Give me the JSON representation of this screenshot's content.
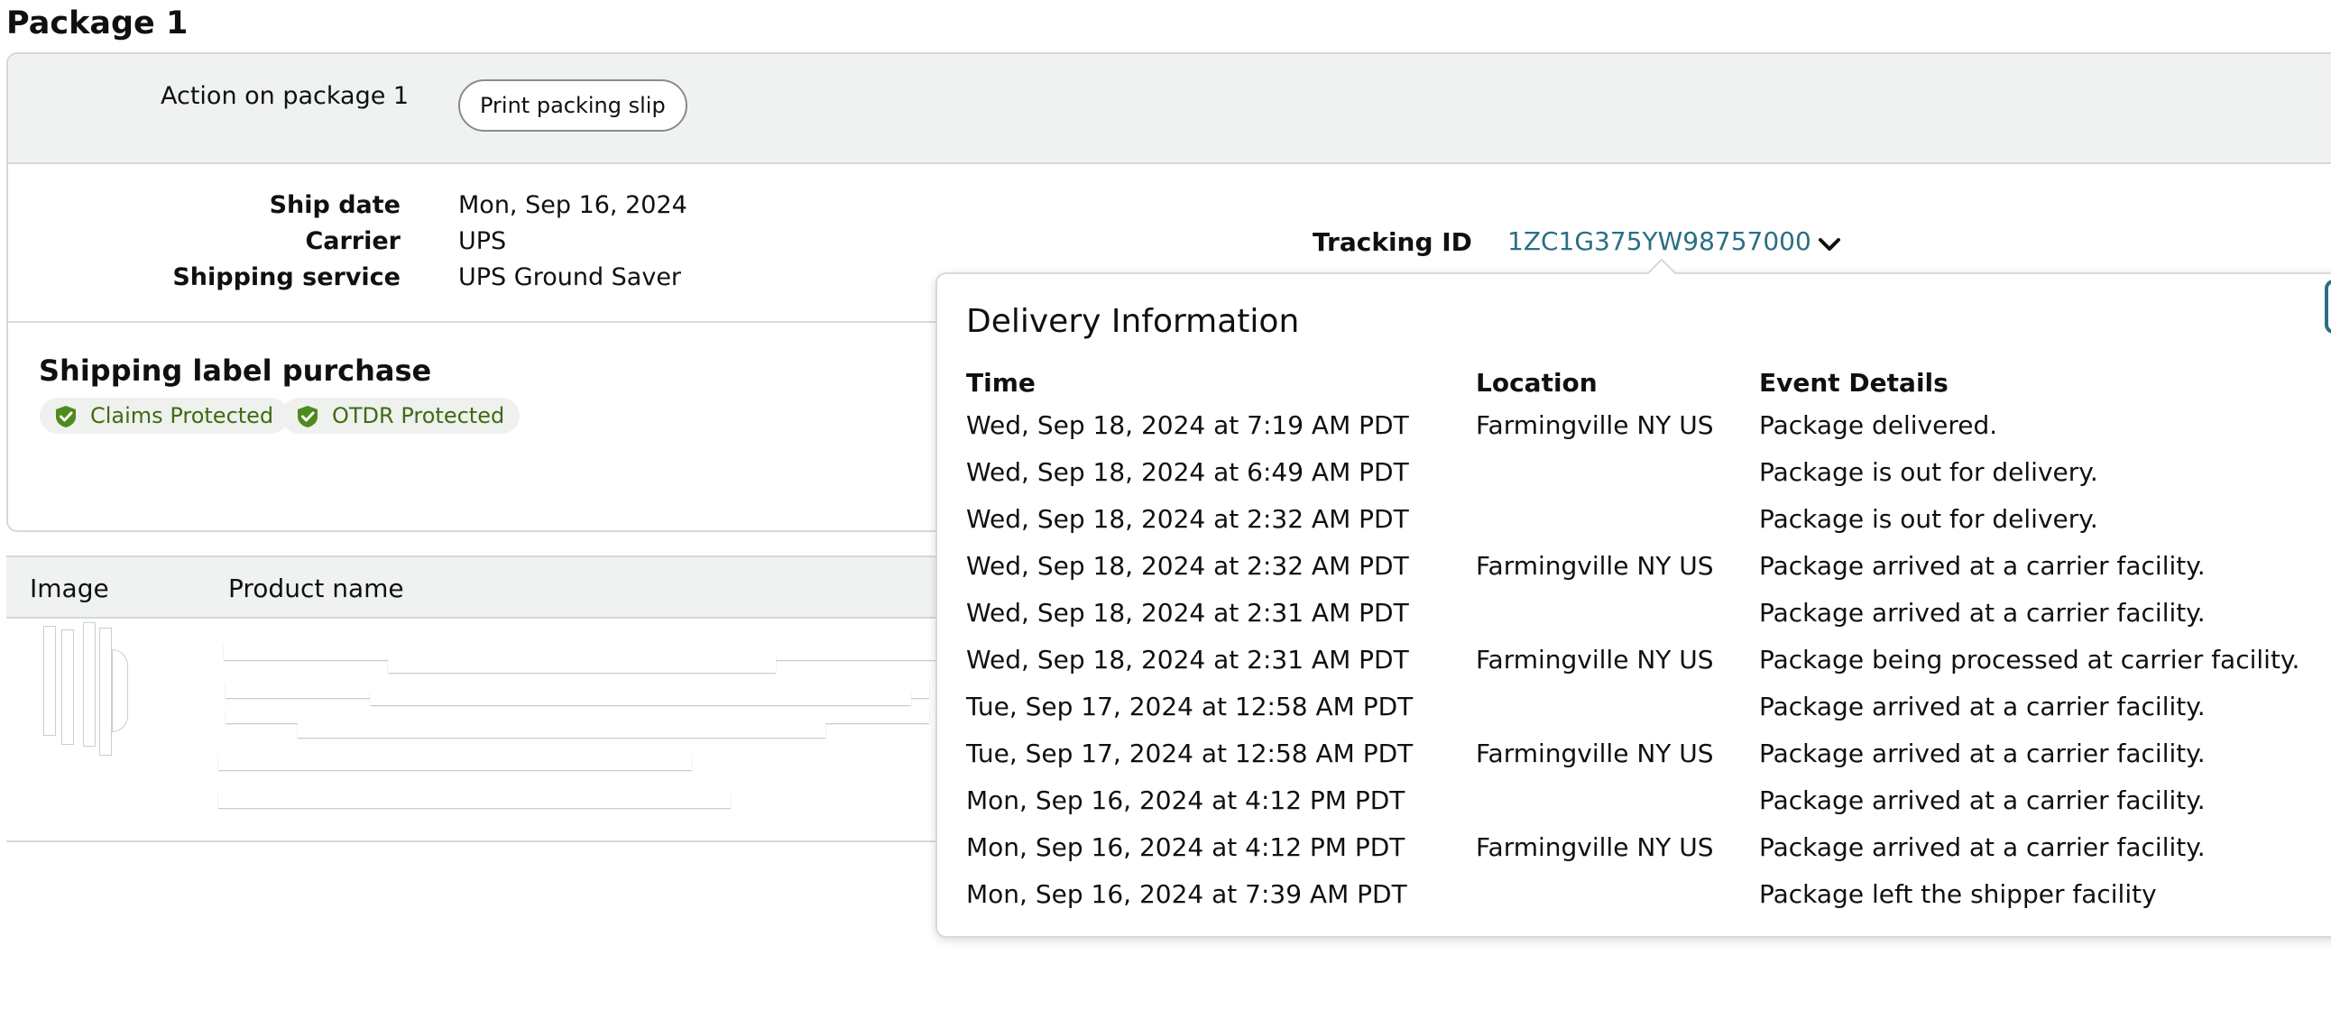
{
  "package": {
    "title": "Package 1",
    "action_label": "Action on package 1",
    "print_button": "Print packing slip",
    "ship_date_label": "Ship date",
    "ship_date": "Mon, Sep 16, 2024",
    "carrier_label": "Carrier",
    "carrier": "UPS",
    "service_label": "Shipping service",
    "service": "UPS Ground Saver",
    "tracking_label": "Tracking ID",
    "tracking_id": "1ZC1G375YW98757000"
  },
  "label_purchase": {
    "title": "Shipping label purchase",
    "badges": [
      "Claims Protected",
      "OTDR Protected"
    ]
  },
  "products_table": {
    "headers": [
      "Image",
      "Product name"
    ]
  },
  "delivery_popover": {
    "title": "Delivery Information",
    "headers": [
      "Time",
      "Location",
      "Event Details"
    ],
    "rows": [
      {
        "time": "Wed, Sep 18, 2024 at 7:19 AM PDT",
        "location": "Farmingville NY US",
        "event": "Package delivered."
      },
      {
        "time": "Wed, Sep 18, 2024 at 6:49 AM PDT",
        "location": "",
        "event": "Package is out for delivery."
      },
      {
        "time": "Wed, Sep 18, 2024 at 2:32 AM PDT",
        "location": "",
        "event": "Package is out for delivery."
      },
      {
        "time": "Wed, Sep 18, 2024 at 2:32 AM PDT",
        "location": "Farmingville NY US",
        "event": "Package arrived at a carrier facility."
      },
      {
        "time": "Wed, Sep 18, 2024 at 2:31 AM PDT",
        "location": "",
        "event": "Package arrived at a carrier facility."
      },
      {
        "time": "Wed, Sep 18, 2024 at 2:31 AM PDT",
        "location": "Farmingville NY US",
        "event": "Package being processed at carrier facility."
      },
      {
        "time": "Tue, Sep 17, 2024 at 12:58 AM PDT",
        "location": "",
        "event": "Package arrived at a carrier facility."
      },
      {
        "time": "Tue, Sep 17, 2024 at 12:58 AM PDT",
        "location": "Farmingville NY US",
        "event": "Package arrived at a carrier facility."
      },
      {
        "time": "Mon, Sep 16, 2024 at 4:12 PM PDT",
        "location": "",
        "event": "Package arrived at a carrier facility."
      },
      {
        "time": "Mon, Sep 16, 2024 at 4:12 PM PDT",
        "location": "Farmingville NY US",
        "event": "Package arrived at a carrier facility."
      },
      {
        "time": "Mon, Sep 16, 2024 at 7:39 AM PDT",
        "location": "",
        "event": "Package left the shipper facility"
      }
    ]
  },
  "icons": {
    "badge_icon": "shield-check-icon",
    "tracking_toggle": "chevron-down-icon"
  },
  "colors": {
    "link": "#2a6f84",
    "badge_text": "#3f6b11",
    "badge_icon": "#4e8a1c"
  }
}
